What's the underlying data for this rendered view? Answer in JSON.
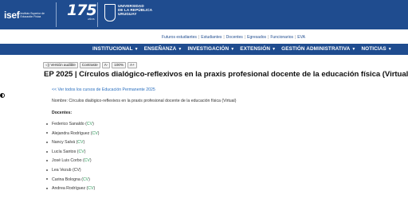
{
  "header": {
    "isef_mark": "isef",
    "isef_sub": "Instituto Superior de Educación Física",
    "anniversary": "175",
    "anniversary_sub": "AÑOS",
    "udelar_lines": [
      "UNIVERSIDAD",
      "DE LA REPÚBLICA",
      "URUGUAY"
    ]
  },
  "subnav": {
    "items": [
      "Futuros estudiantes",
      "Estudiantes",
      "Docentes",
      "Egresados",
      "Funcionarios",
      "EVA"
    ]
  },
  "mainnav": {
    "items": [
      {
        "label": "INSTITUCIONAL",
        "icon": "chevron-down-icon"
      },
      {
        "label": "ENSEÑANZA",
        "icon": "chevron-down-icon"
      },
      {
        "label": "INVESTIGACIÓN",
        "icon": "chevron-down-icon"
      },
      {
        "label": "EXTENSIÓN",
        "icon": "chevron-down-icon"
      },
      {
        "label": "GESTIÓN ADMINISTRATIVA",
        "icon": "chevron-down-icon"
      },
      {
        "label": "NOTICIAS",
        "icon": "chevron-down-icon"
      }
    ]
  },
  "accessibility": {
    "audio": "◁) Versión audible",
    "contrast": "Contraste",
    "decrease": "A-",
    "zoom": "100%",
    "increase": "A+"
  },
  "page": {
    "title": "EP 2025 | Círculos dialógico-reflexivos en la praxis profesional docente de la educación física (Virtual)",
    "back_link": "<< Ver todos los cursos de Educación Permanente 2025",
    "nombre": "Nombre: Círculos dialógico-reflexivos en la praxis profesional docente de la educación física (Virtual)",
    "docentes_label": "Docentes:",
    "docentes": [
      {
        "name": "Federico Sanaldo",
        "cv": "CV",
        "linked": true
      },
      {
        "name": "Alejandra Rodríguez",
        "cv": "CV",
        "linked": true
      },
      {
        "name": "Nancy Salvá",
        "cv": "CV",
        "linked": true
      },
      {
        "name": "Lucía Santos",
        "cv": "CV",
        "linked": true
      },
      {
        "name": "José Luis Corbo",
        "cv": "CV",
        "linked": true
      },
      {
        "name": "Lea Vezub",
        "cv": "CV",
        "linked": false
      },
      {
        "name": "Carina Bologna",
        "cv": "CV",
        "linked": true
      },
      {
        "name": "Andrea Rodríguez",
        "cv": "CV",
        "linked": true
      }
    ]
  },
  "colors": {
    "brand_blue": "#1f4c8f",
    "link_blue": "#2a6fbf",
    "cv_green": "#2e9a5a"
  }
}
